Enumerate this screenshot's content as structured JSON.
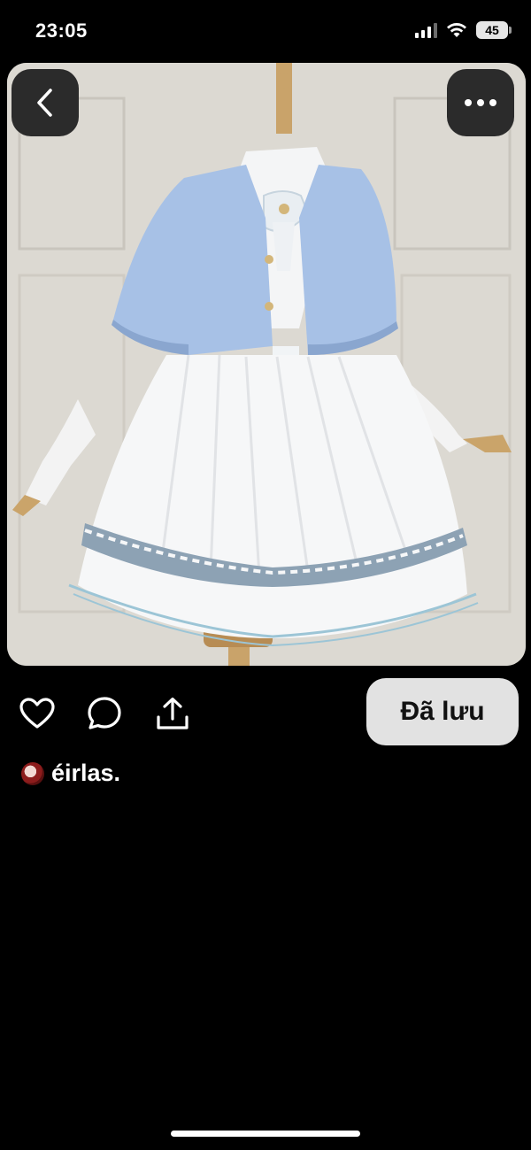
{
  "status_bar": {
    "time": "23:05",
    "battery": "45"
  },
  "pin": {
    "saved_label": "Đã lưu",
    "author_name": "éirlas."
  },
  "icons": {
    "back": "chevron-left-icon",
    "more": "more-horizontal-icon",
    "like": "heart-icon",
    "comment": "comment-icon",
    "share": "share-icon"
  },
  "colors": {
    "background": "#000000",
    "saved_button": "#e2e2e2",
    "cape_blue": "#a7c1e6"
  }
}
